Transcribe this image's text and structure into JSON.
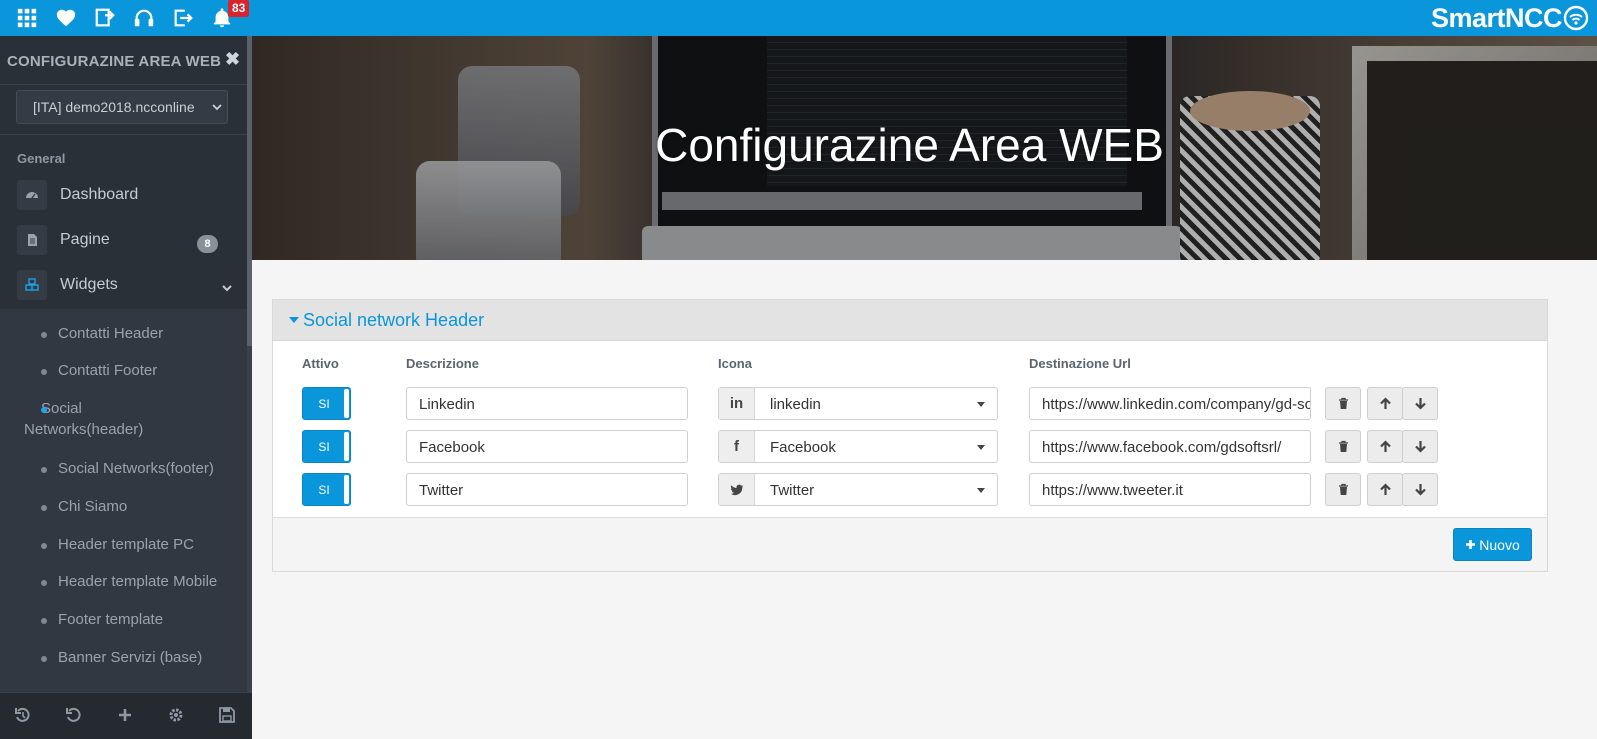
{
  "topbar": {
    "icons": [
      "apps-grid-icon",
      "heart-icon",
      "screen-icon",
      "headset-icon",
      "logout-icon",
      "bell-icon"
    ],
    "notifications_count": "83",
    "logo_text": "SmartNCC",
    "brand_color": "#0a96da"
  },
  "sidebar": {
    "title": "CONFIGURAZINE AREA WEB",
    "close_glyph": "✖",
    "site_select": "[ITA]   demo2018.ncconline",
    "section_label": "General",
    "items": [
      {
        "label": "Dashboard",
        "icon": "dashboard-icon"
      },
      {
        "label": "Pagine",
        "icon": "page-icon",
        "count": "8"
      },
      {
        "label": "Widgets",
        "icon": "cubes-icon"
      }
    ],
    "widgets_sub": [
      {
        "label": "Contatti Header"
      },
      {
        "label": "Contatti Footer"
      },
      {
        "label": "Social Networks(header)",
        "active": true
      },
      {
        "label": "Social Networks(footer)"
      },
      {
        "label": "Chi Siamo"
      },
      {
        "label": "Header template PC"
      },
      {
        "label": "Header template Mobile"
      },
      {
        "label": "Footer template"
      },
      {
        "label": "Banner Servizi (base)"
      }
    ],
    "footer_icons": [
      "undo-icon",
      "refresh-icon",
      "add-icon",
      "settings-icon",
      "save-icon"
    ]
  },
  "hero": {
    "title": "Configurazine Area WEB"
  },
  "panel": {
    "title": "Social network Header",
    "columns": {
      "active": "Attivo",
      "description": "Descrizione",
      "icon": "Icona",
      "url": "Destinazione Url"
    },
    "rows": [
      {
        "active": "SI",
        "description": "Linkedin",
        "icon_glyph": "in",
        "icon_name": "linkedin",
        "url": "https://www.linkedin.com/company/gd-soft"
      },
      {
        "active": "SI",
        "description": "Facebook",
        "icon_glyph": "f",
        "icon_name": "Facebook",
        "url": "https://www.facebook.com/gdsoftsrl/"
      },
      {
        "active": "SI",
        "description": "Twitter",
        "icon_glyph": "twitter",
        "icon_name": "Twitter",
        "url": "https://www.tweeter.it"
      }
    ],
    "new_button": "Nuovo"
  }
}
